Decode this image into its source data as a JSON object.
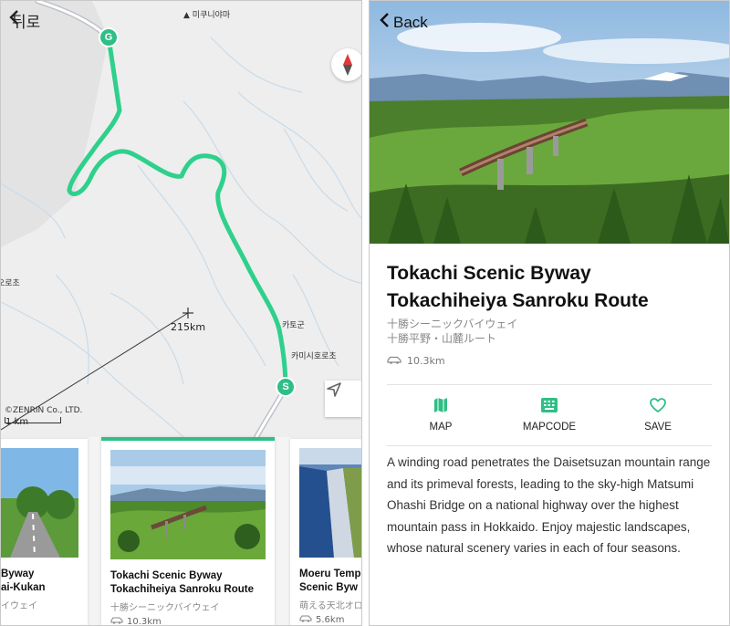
{
  "left": {
    "back_label": "뒤로",
    "map": {
      "labels": {
        "top": "미쿠니야마",
        "edge": "오로초",
        "karo": "카토군",
        "kamishi": "카미시호로초"
      },
      "distance": "215km",
      "copyright": "©ZENRIN Co., LTD.",
      "scale": "1 km",
      "start_marker": "S",
      "goal_marker": "G",
      "route_color": "#2fd08c"
    },
    "cards": [
      {
        "title1": "Byway",
        "title2": "ai-Kukan",
        "jp": "イウェイ",
        "distance": ""
      },
      {
        "title1": "Tokachi Scenic Byway",
        "title2": "Tokachiheiya Sanroku Route",
        "jp": "十勝シーニックバイウェイ",
        "distance": "10.3km"
      },
      {
        "title1": "Moeru Temp",
        "title2": "Scenic Byw",
        "jp": "萌える天北オロ",
        "distance": "5.6km"
      }
    ]
  },
  "right": {
    "back_label": "Back",
    "title_line1": "Tokachi Scenic Byway",
    "title_line2": "Tokachiheiya Sanroku Route",
    "jp_line1": "十勝シーニックバイウェイ",
    "jp_line2": "十勝平野・山麓ルート",
    "distance": "10.3km",
    "actions": {
      "map": "MAP",
      "mapcode": "MAPCODE",
      "save": "SAVE"
    },
    "accent_color": "#2fbf86",
    "description": "A winding road penetrates the Daisetsuzan mountain range and its primeval forests, leading to the sky-high Matsumi Ohashi Bridge on a national highway over the highest mountain pass in Hokkaido. Enjoy majestic landscapes, whose natural scenery varies in each of four seasons."
  }
}
